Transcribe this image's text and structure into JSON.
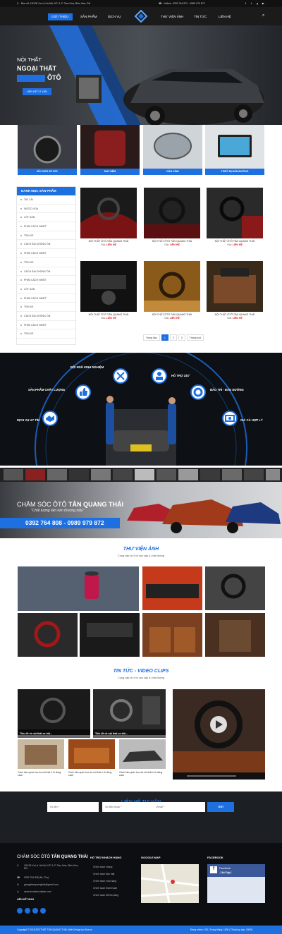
{
  "topbar": {
    "address": "Địa chỉ: 18/108 Xa Lộ Hà Nội, KP. 3, P. Tam Hòa, Biên Hòa, ĐN",
    "hotline": "Hotline: 0392 764 872 - 0989 979 872"
  },
  "nav": {
    "items": [
      "GIỚI THIỆU",
      "SẢN PHẨM",
      "DỊCH VỤ",
      "THƯ VIỆN ẢNH",
      "TIN TỨC",
      "LIÊN HỆ"
    ]
  },
  "hero": {
    "line1": "NỘI THẤT",
    "line2": "NGOẠI THẤT",
    "line3": "ÔTÔ",
    "button": "LIÊN HỆ TƯ VẤN"
  },
  "categories": [
    "ĐỒ CHƠI XE HƠI",
    "MAY NỆM",
    "GẦN KÍNH",
    "THIẾT BỊ DẪN ĐƯỜNG"
  ],
  "sidebar": {
    "title": "DANH MỤC SẢN PHẨM",
    "items": [
      "TAY LÁI",
      "NƯỚC HOA",
      "LÓT SÀN",
      "PHIM CÁCH NHIỆT",
      "TEM XE",
      "CÁCH ÂM CHỐNG ỒN",
      "PHIM CÁCH NHIỆT",
      "TEM XE",
      "CÁCH ÂM CHỐNG ỒN",
      "PHIM CÁCH NHIỆT",
      "LÓT SÀN",
      "PHIM CÁCH NHIỆT",
      "TEM XE",
      "CÁCH ÂM CHỐNG ỒN",
      "PHIM CÁCH NHIỆT",
      "TEM XE"
    ]
  },
  "products": {
    "name": "NỘI THẤT ÔTÔ TÂN QUANG THÁI",
    "price_label": "Giá:",
    "price_value": "LIÊN HỆ"
  },
  "pager": [
    "Trang đầu",
    "1",
    "2",
    "3",
    "Trang cuối"
  ],
  "why": {
    "items": [
      "ĐỘI NGŨ KINH NGHIỆM",
      "HỖ TRỢ 24/7",
      "SẢN PHẨM CHẤT LƯỢNG",
      "BẢO TRÌ - BẢO DƯỠNG",
      "DỊCH VỤ UY TÍN",
      "GIÁ CẢ HỢP LÝ"
    ]
  },
  "promo": {
    "title_a": "CHĂM SÓC ÔTÔ",
    "title_b": "TÂN QUANG THÁI",
    "quote": "\"Chất lượng làm nên thương hiệu\"",
    "phones": "0392 764 808 - 0989 979 872"
  },
  "gallery": {
    "title": "THƯ VIỆN ẢNH",
    "sub": "Cung cấp xe ô tô cao cấp & chất lượng"
  },
  "news": {
    "title": "TIN TỨC - VIDEO CLIPS",
    "sub": "Cung cấp xe ô tô cao cấp & chất lượng",
    "big1": "Tiêu đề về nội thất xe ôtô...",
    "big2": "Tiêu đề về nội thất xe ôtô...",
    "small1": "Cách bảo quản bọc da nội thất ô tô đúng cách",
    "small2": "Cách bảo quản bọc da nội thất ô tô đúng cách",
    "small3": "Cách bảo quản bọc da nội thất ô tô đúng cách"
  },
  "consult": {
    "title": "LIÊN HỆ TƯ VẤN",
    "sub": "Điền đầy đủ thông tin để nhận được thông tin",
    "name_ph": "Họ tên *",
    "phone_ph": "Số điện thoại *",
    "email_ph": "Email *",
    "submit": "GỬI"
  },
  "footer": {
    "brand_a": "CHĂM SÓC ÔTÔ",
    "brand_b": "TÂN QUANG THÁI",
    "addr": "18/108 Xa Lộ Hà Nội, KP. 3, P. Tam Hòa, Biên Hòa, ĐN",
    "phone": "0392 764 808 (Mr. Thụ)",
    "email": "garagetanquangthai@gmail.com",
    "web": "www.tenmiencuaban.com",
    "social_title": "LIÊN KẾT MXH",
    "col2": "HỖ TRỢ KHÁCH HÀNG",
    "col2_items": [
      "Chính sách chung",
      "Chính sách bảo mật",
      "Chính sách mua hàng",
      "Chính sách thanh toán",
      "Chính sách đổi trả hàng"
    ],
    "col3": "GOOGLE MAP",
    "col4": "FACEBOOK",
    "fb_name": "Facebook",
    "fb_like": "Like Page"
  },
  "copyright": {
    "left": "Copyright © 2018 NỘI THẤT TÂN QUANG THÁI, Web Design by Nina.vn",
    "right": "Đang online: 150 | Trong tháng: 1500 | Tổng truy cập: 15000"
  },
  "colors": {
    "accent": "#1e6fe0",
    "dark": "#111111"
  }
}
